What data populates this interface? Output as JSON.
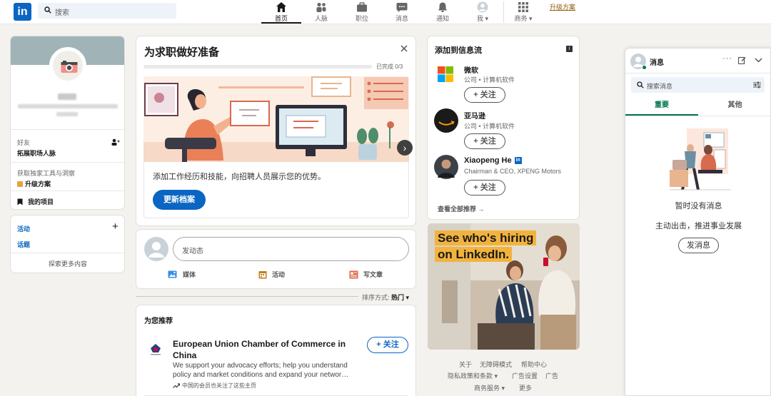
{
  "nav": {
    "logo": "in",
    "search_placeholder": "搜索",
    "items": [
      {
        "label": "首页",
        "icon": "home-icon"
      },
      {
        "label": "人脉",
        "icon": "network-icon"
      },
      {
        "label": "职位",
        "icon": "briefcase-icon"
      },
      {
        "label": "消息",
        "icon": "message-icon"
      },
      {
        "label": "通知",
        "icon": "bell-icon"
      },
      {
        "label": "我 ▾",
        "icon": "avatar-icon"
      },
      {
        "label": "商务 ▾",
        "icon": "grid-icon"
      }
    ],
    "premium": "升级方案"
  },
  "profile": {
    "friends_label": "好友",
    "friends_cta": "拓展职场人脉",
    "tools_text": "获取独家工具与洞察",
    "upgrade": "升级方案",
    "my_items": "我的项目",
    "activity": "活动",
    "topics": "话题",
    "explore": "探索更多内容"
  },
  "job_prep": {
    "title": "为求职做好准备",
    "progress_text": "已完成 0/3",
    "progress": 0,
    "description": "添加工作经历和技能，向招聘人员展示您的优势。",
    "button": "更新档案"
  },
  "composer": {
    "placeholder": "发动态",
    "actions": [
      {
        "label": "媒体",
        "icon": "image-icon",
        "color": "#378fe9"
      },
      {
        "label": "活动",
        "icon": "calendar-icon",
        "color": "#c37d16"
      },
      {
        "label": "写文章",
        "icon": "article-icon",
        "color": "#e06847"
      }
    ]
  },
  "sort": {
    "label": "排序方式:",
    "value": "热门 ▾"
  },
  "recommend": {
    "title": "为您推荐",
    "org": "European Union Chamber of Commerce in China",
    "desc": "We support your advocacy efforts; help you understand policy and market conditions and expand your networ…",
    "note": "中国的会员也关注了这些主页",
    "follow": "+ 关注"
  },
  "feed_add": {
    "title": "添加到信息流",
    "items": [
      {
        "name": "微软",
        "sub": "公司 • 计算机软件",
        "follow": "+ 关注"
      },
      {
        "name": "亚马逊",
        "sub": "公司 • 计算机软件",
        "follow": "+ 关注"
      },
      {
        "name": "Xiaopeng He",
        "sub": "Chairman & CEO, XPENG Motors",
        "follow": "+ 关注"
      }
    ],
    "view_all": "查看全部推荐 →"
  },
  "ad": {
    "line1": "See who's hiring",
    "line2": "on LinkedIn."
  },
  "footer": {
    "links": [
      "关于",
      "无障碍模式",
      "帮助中心",
      "隐私政策和条款 ▾",
      "广告设置",
      "广告",
      "商务服务 ▾",
      "更多"
    ]
  },
  "messaging": {
    "title": "消息",
    "search_placeholder": "搜索消息",
    "tabs": [
      "重要",
      "其他"
    ],
    "empty_title": "暂时没有消息",
    "empty_sub": "主动出击，推进事业发展",
    "send": "发消息"
  },
  "colors": {
    "brand": "#0a66c2",
    "accent_green": "#01754f",
    "premium": "#915907"
  }
}
